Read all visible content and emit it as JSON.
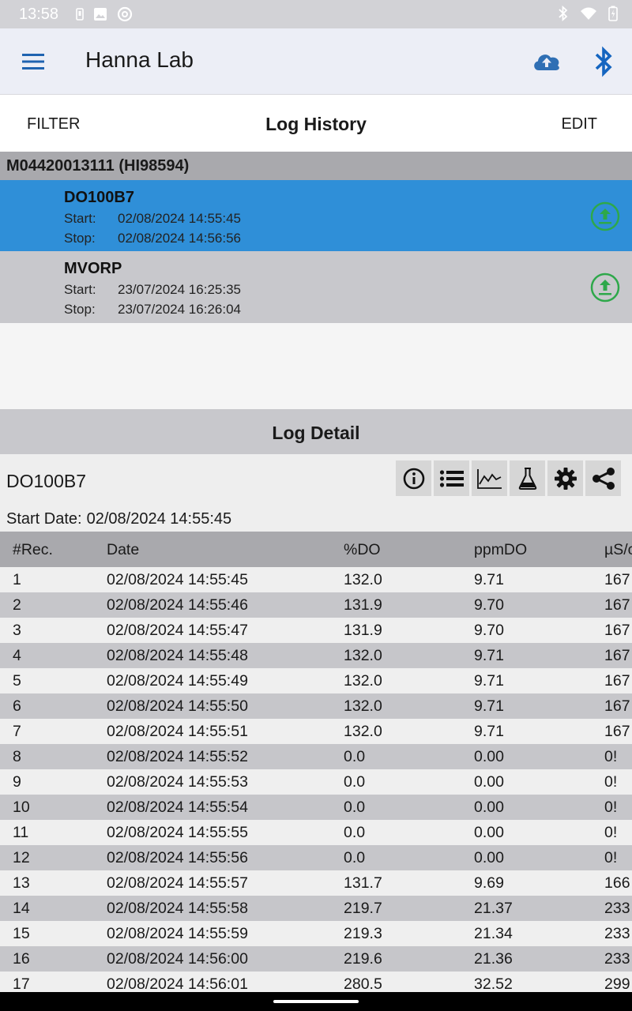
{
  "status_bar": {
    "time": "13:58"
  },
  "app_bar": {
    "title": "Hanna Lab"
  },
  "toolbar": {
    "filter_label": "FILTER",
    "title": "Log History",
    "edit_label": "EDIT"
  },
  "device": {
    "header": "M04420013111 (HI98594)"
  },
  "logs": [
    {
      "name": "DO100B7",
      "start_label": "Start:",
      "start": "02/08/2024 14:55:45",
      "stop_label": "Stop:",
      "stop": "02/08/2024 14:56:56"
    },
    {
      "name": "MVORP",
      "start_label": "Start:",
      "start": "23/07/2024 16:25:35",
      "stop_label": "Stop:",
      "stop": "23/07/2024 16:26:04"
    }
  ],
  "detail": {
    "header": "Log Detail",
    "name": "DO100B7",
    "start_label": "Start Date:",
    "start_value": "02/08/2024 14:55:45",
    "icons": [
      "info-icon",
      "list-icon",
      "chart-icon",
      "flask-icon",
      "gear-icon",
      "share-icon"
    ]
  },
  "table": {
    "columns": [
      "#Rec.",
      "Date",
      "%DO",
      "ppmDO",
      "µS/c"
    ],
    "rows": [
      [
        "1",
        "02/08/2024 14:55:45",
        "132.0",
        "9.71",
        "167"
      ],
      [
        "2",
        "02/08/2024 14:55:46",
        "131.9",
        "9.70",
        "167"
      ],
      [
        "3",
        "02/08/2024 14:55:47",
        "131.9",
        "9.70",
        "167"
      ],
      [
        "4",
        "02/08/2024 14:55:48",
        "132.0",
        "9.71",
        "167"
      ],
      [
        "5",
        "02/08/2024 14:55:49",
        "132.0",
        "9.71",
        "167"
      ],
      [
        "6",
        "02/08/2024 14:55:50",
        "132.0",
        "9.71",
        "167"
      ],
      [
        "7",
        "02/08/2024 14:55:51",
        "132.0",
        "9.71",
        "167"
      ],
      [
        "8",
        "02/08/2024 14:55:52",
        "0.0",
        "0.00",
        "0!"
      ],
      [
        "9",
        "02/08/2024 14:55:53",
        "0.0",
        "0.00",
        "0!"
      ],
      [
        "10",
        "02/08/2024 14:55:54",
        "0.0",
        "0.00",
        "0!"
      ],
      [
        "11",
        "02/08/2024 14:55:55",
        "0.0",
        "0.00",
        "0!"
      ],
      [
        "12",
        "02/08/2024 14:55:56",
        "0.0",
        "0.00",
        "0!"
      ],
      [
        "13",
        "02/08/2024 14:55:57",
        "131.7",
        "9.69",
        "166"
      ],
      [
        "14",
        "02/08/2024 14:55:58",
        "219.7",
        "21.37",
        "233"
      ],
      [
        "15",
        "02/08/2024 14:55:59",
        "219.3",
        "21.34",
        "233"
      ],
      [
        "16",
        "02/08/2024 14:56:00",
        "219.6",
        "21.36",
        "233"
      ],
      [
        "17",
        "02/08/2024 14:56:01",
        "280.5",
        "32.52",
        "299"
      ]
    ]
  },
  "colors": {
    "selected_row": "#2f8fd8",
    "upload_icon": "#2ea84a",
    "cloud_icon": "#2f6fb4",
    "bluetooth_icon": "#1565c0"
  }
}
